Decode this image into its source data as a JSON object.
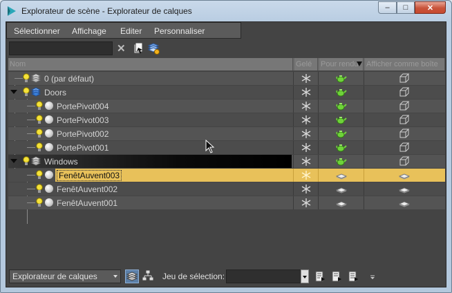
{
  "window": {
    "title": "Explorateur de scène - Explorateur de calques",
    "minimize_label": "–",
    "maximize_label": "□",
    "close_label": "✕"
  },
  "menu": [
    "Sélectionner",
    "Affichage",
    "Editer",
    "Personnaliser"
  ],
  "toolbar": {
    "search_value": "",
    "clear_label": "✕"
  },
  "columns": {
    "name": "Nom",
    "frozen": "Gelé",
    "render": "Pour rendu",
    "box": "Afficher comme boîte"
  },
  "rows": [
    {
      "label": "0 (par défaut)",
      "type": "layer",
      "level": 0,
      "expandable": false,
      "render_icon": "teapot-icon",
      "box_icon": "wire-box-icon"
    },
    {
      "label": "Doors",
      "type": "layer",
      "level": 0,
      "expandable": true,
      "render_icon": "teapot-icon",
      "box_icon": "wire-box-icon"
    },
    {
      "label": "PortePivot004",
      "type": "object",
      "level": 1,
      "render_icon": "teapot-icon",
      "box_icon": "wire-box-icon"
    },
    {
      "label": "PortePivot003",
      "type": "object",
      "level": 1,
      "render_icon": "teapot-icon",
      "box_icon": "wire-box-icon"
    },
    {
      "label": "PortePivot002",
      "type": "object",
      "level": 1,
      "render_icon": "teapot-icon",
      "box_icon": "wire-box-icon"
    },
    {
      "label": "PortePivot001",
      "type": "object",
      "level": 1,
      "render_icon": "teapot-icon",
      "box_icon": "wire-box-icon"
    },
    {
      "label": "Windows",
      "type": "layer",
      "level": 0,
      "expandable": true,
      "active": true,
      "render_icon": "teapot-icon",
      "box_icon": "wire-box-icon"
    },
    {
      "label": "FenêtAuvent003",
      "type": "object",
      "level": 1,
      "selected": true,
      "render_icon": "plate-icon",
      "box_icon": "plate-icon"
    },
    {
      "label": "FenêtAuvent002",
      "type": "object",
      "level": 1,
      "render_icon": "plate-icon",
      "box_icon": "plate-icon"
    },
    {
      "label": "FenêtAuvent001",
      "type": "object",
      "level": 1,
      "render_icon": "plate-icon",
      "box_icon": "plate-icon"
    }
  ],
  "statusbar": {
    "explorer_select": "Explorateur de calques",
    "selection_set_label": "Jeu de sélection:",
    "selection_set_value": ""
  },
  "colors": {
    "selected_row": "#e8c15a",
    "layer_blue": "#3a7fd6",
    "teapot_green": "#6fd23a"
  }
}
